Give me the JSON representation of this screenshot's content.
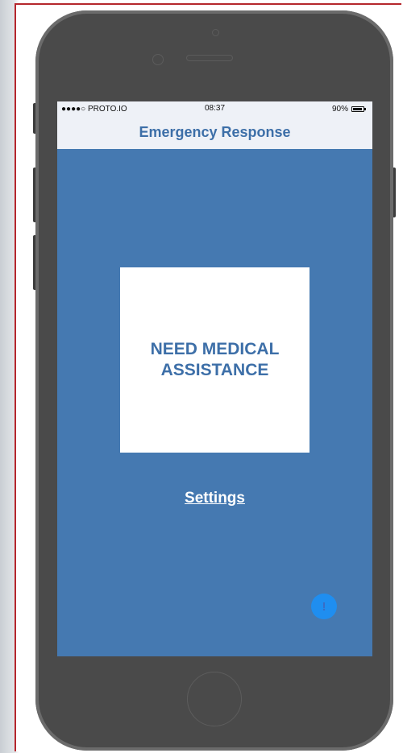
{
  "status_bar": {
    "carrier": "●●●●○ PROTO.IO",
    "time": "08:37",
    "battery": "90%"
  },
  "header": {
    "title": "Emergency Response"
  },
  "main": {
    "medical_button_label": "NEED MEDICAL ASSISTANCE",
    "settings_link": "Settings"
  },
  "fab": {
    "glyph": "!"
  },
  "colors": {
    "screen_background": "#4579b1",
    "accent": "#3d6fa8",
    "fab": "#1f8ef0",
    "frame_border": "#b5272d"
  }
}
